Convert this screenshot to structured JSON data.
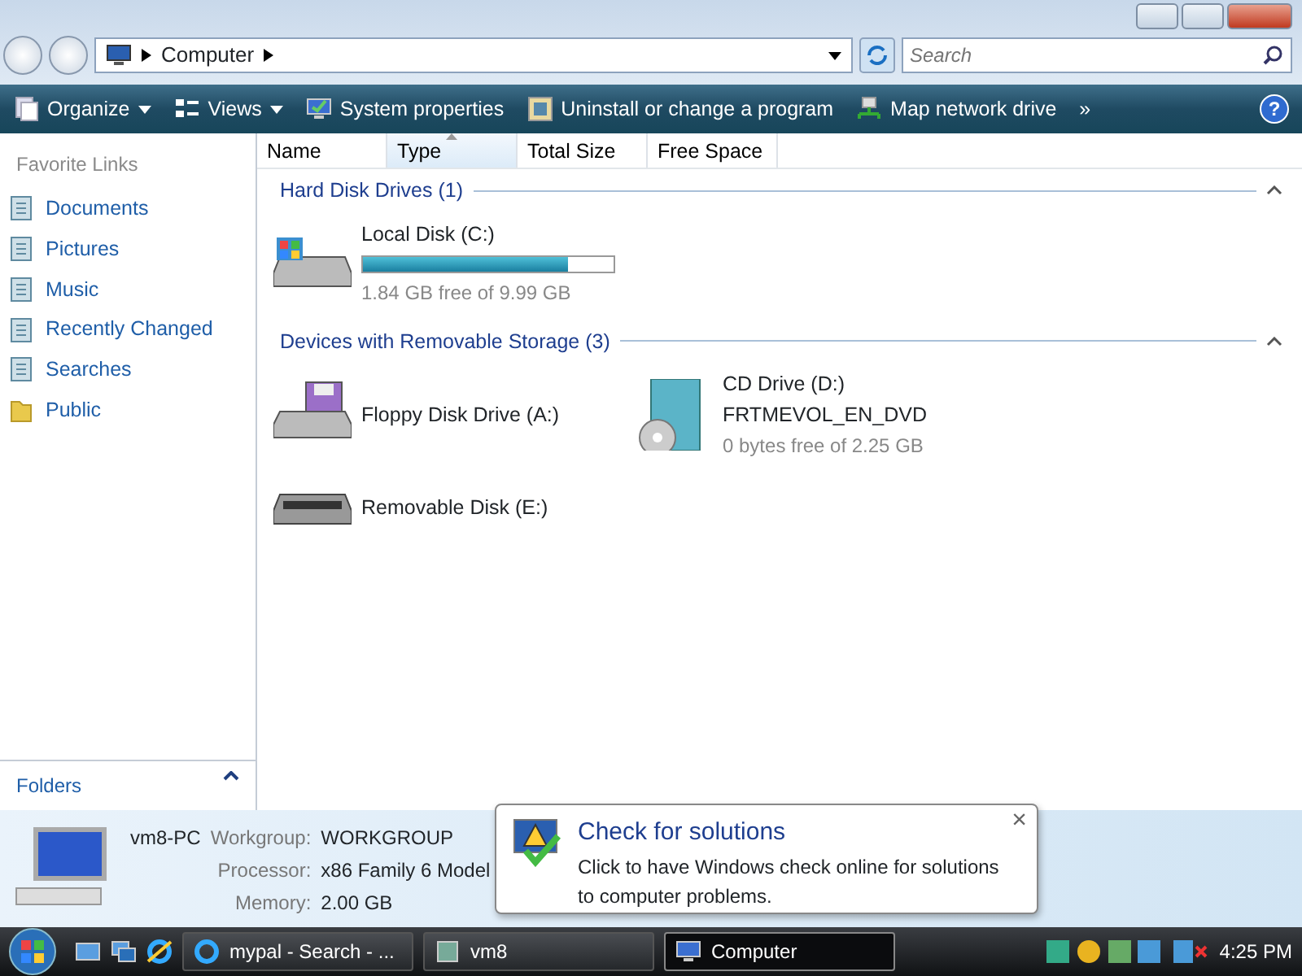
{
  "address_bar": {
    "path": "Computer",
    "search_placeholder": "Search"
  },
  "toolbar": [
    {
      "label": "Organize",
      "kind": "organize",
      "menu": true
    },
    {
      "label": "Views",
      "kind": "views",
      "menu": true
    },
    {
      "label": "System properties",
      "kind": "system",
      "menu": false
    },
    {
      "label": "Uninstall or change a program",
      "kind": "uninstall",
      "menu": false
    },
    {
      "label": "Map network drive",
      "kind": "network",
      "menu": false
    }
  ],
  "toolbar_more": "»",
  "toolbar_help": "?",
  "sidebar": {
    "title": "Favorite Links",
    "items": [
      {
        "label": "Documents",
        "kind": "doc"
      },
      {
        "label": "Pictures",
        "kind": "doc"
      },
      {
        "label": "Music",
        "kind": "doc"
      },
      {
        "label": "Recently Changed",
        "kind": "doc"
      },
      {
        "label": "Searches",
        "kind": "doc"
      },
      {
        "label": "Public",
        "kind": "folder"
      }
    ],
    "folders": "Folders"
  },
  "columns": [
    {
      "label": "Name",
      "sorted": false
    },
    {
      "label": "Type",
      "sorted": true
    },
    {
      "label": "Total Size",
      "sorted": false
    },
    {
      "label": "Free Space",
      "sorted": false
    }
  ],
  "groups": [
    {
      "title": "Hard Disk Drives (1)",
      "items": [
        {
          "kind": "hdd",
          "name": "Local Disk (C:)",
          "level": 0.82,
          "info": "1.84 GB free of 9.99 GB"
        }
      ]
    },
    {
      "title": "Devices with Removable Storage (3)",
      "items": [
        {
          "kind": "floppy",
          "name": "Floppy Disk Drive (A:)"
        },
        {
          "kind": "cd",
          "name": "CD Drive (D:)",
          "label": "FRTMEVOL_EN_DVD",
          "info": "0 bytes free of 2.25 GB"
        },
        {
          "kind": "removable",
          "name": "Removable Disk (E:)"
        }
      ]
    }
  ],
  "details": {
    "computer": "vm8-PC",
    "fields": [
      {
        "label": "Workgroup:",
        "value": "WORKGROUP"
      },
      {
        "label": "Processor:",
        "value": "x86 Family 6 Model"
      },
      {
        "label": "Memory:",
        "value": "2.00 GB"
      }
    ]
  },
  "balloon": {
    "title": "Check for solutions",
    "text": "Click to have Windows check online for solutions to computer problems.",
    "close": "×"
  },
  "taskbar": {
    "items": [
      {
        "label": "mypal - Search - ...",
        "kind": "ie",
        "selected": false
      },
      {
        "label": "vm8",
        "kind": "vm",
        "selected": false
      },
      {
        "label": "Computer",
        "kind": "computer",
        "selected": true
      }
    ],
    "clock": "4:25 PM"
  }
}
